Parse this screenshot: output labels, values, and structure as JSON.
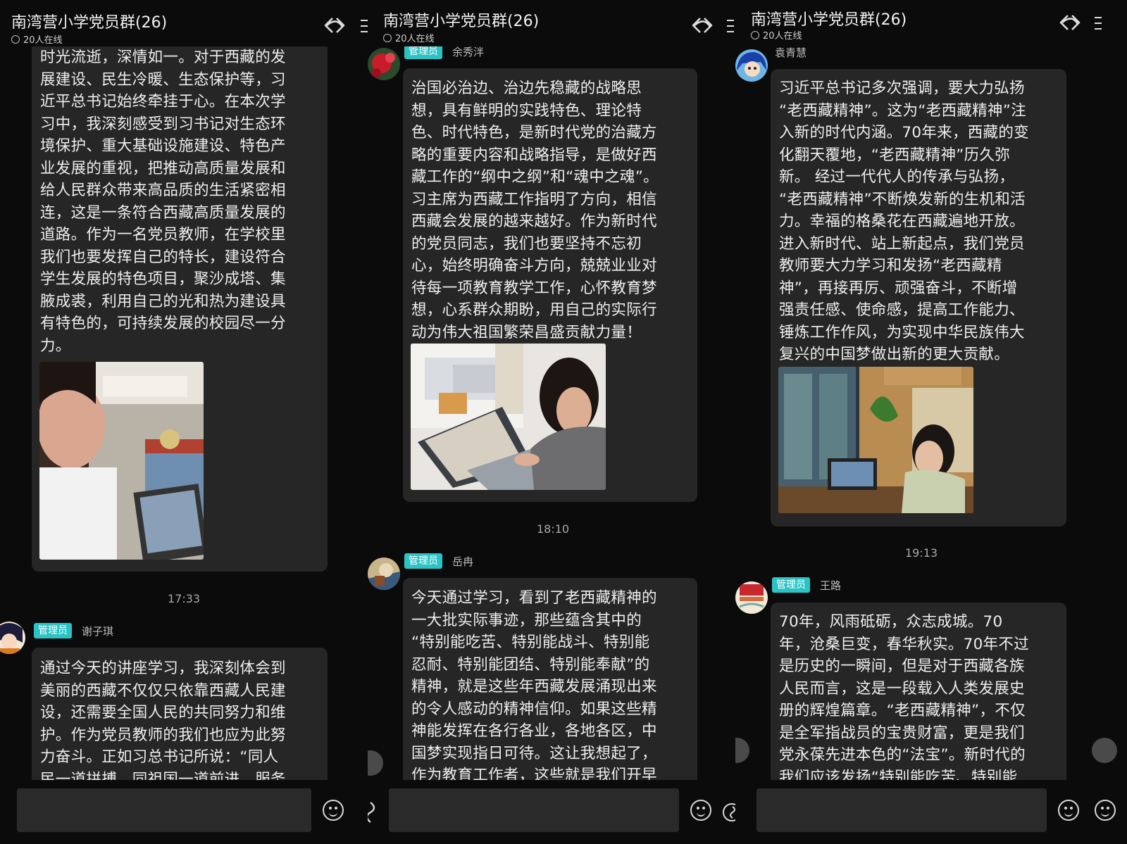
{
  "title": "南湾营小学党员群(26)",
  "online": "20人在线",
  "badge": "管理员",
  "panel1": {
    "msg1_text": "时光流逝，深情如一。对于西藏的发\n展建设、民生冷暖、生态保护等，习\n近平总书记始终牵挂于心。在本次学\n习中，我深刻感受到习书记对生态环\n境保护、重大基础设施建设、特色产\n业发展的重视，把推动高质量发展和\n给人民群众带来高品质的生活紧密相\n连，这是一条符合西藏高质量发展的\n道路。作为一名党员教师，在学校里\n我们也要发挥自己的特长，建设符合\n学生发展的特色项目，聚沙成塔、集\n腋成裘，利用自己的光和热为建设具\n有特色的，可持续发展的校园尽一分\n力。",
    "time": "17:33",
    "sender2": "谢子琪",
    "msg2_text": "通过今天的讲座学习，我深刻体会到\n美丽的西藏不仅仅只依靠西藏人民建\n设，还需要全国人民的共同努力和维\n护。作为党员教师的我们也应为此努\n力奋斗。正如习总书记所说：“同人\n民一道拼搏、同祖国一道前进，服务"
  },
  "panel2": {
    "sender1": "余秀泮",
    "msg1_text": "治国必治边、治边先稳藏的战略思\n想，具有鲜明的实践特色、理论特\n色、时代特色，是新时代党的治藏方\n略的重要内容和战略指导，是做好西\n藏工作的“纲中之纲”和“魂中之魂”。\n习主席为西藏工作指明了方向，相信\n西藏会发展的越来越好。作为新时代\n的党员同志，我们也要坚持不忘初\n心，始终明确奋斗方向，兢兢业业对\n待每一项教育教学工作，心怀教育梦\n想，心系群众期盼，用自己的实际行\n动为伟大祖国繁荣昌盛贡献力量！",
    "time": "18:10",
    "sender2": "岳冉",
    "msg2_text": "今天通过学习，看到了老西藏精神的\n一大批实际事迹，那些蕴含其中的\n“特别能吃苦、特别能战斗、特别能\n忍耐、特别能团结、特别能奉献”的\n精神，就是这些年西藏发展涌现出来\n的令人感动的精神信仰。如果这些精\n神能发挥在各行各业，各地各区，中\n国梦实现指日可待。这让我想起了，\n作为教育工作者，这些就是我们开早"
  },
  "panel3": {
    "sender1": "袁青慧",
    "msg1_text": "习近平总书记多次强调，要大力弘扬\n“老西藏精神”。这为“老西藏精神”注\n入新的时代内涵。70年来，西藏的变\n化翻天覆地，“老西藏精神”历久弥\n新。 经过一代代人的传承与弘扬，\n“老西藏精神”不断焕发新的生机和活\n力。幸福的格桑花在西藏遍地开放。\n进入新时代、站上新起点，我们党员\n教师要大力学习和发扬“老西藏精\n神”，再接再厉、顽强奋斗，不断增\n强责任感、使命感，提高工作能力、\n锤炼工作作风，为实现中华民族伟大\n复兴的中国梦做出新的更大贡献。",
    "time": "19:13",
    "sender2": "王路",
    "msg2_text": "70年，风雨砥砺，众志成城。70\n年，沧桑巨变，春华秋实。70年不过\n是历史的一瞬间，但是对于西藏各族\n人民而言，这是一段载入人类发展史\n册的辉煌篇章。“老西藏精神”，不仅\n是全军指战员的宝贵财富，更是我们\n党永葆先进本色的“法宝”。新时代的\n我们应该发扬“特别能吃苦、特别能"
  },
  "icons": {
    "share": "share-icon",
    "menu": "menu-icon",
    "emoji": "emoji-icon",
    "voice": "voice-icon",
    "check": "check-circle-icon"
  },
  "colors": {
    "background": "#0b0b0b",
    "bubble": "#262626",
    "badge": "#2bc4c6",
    "text": "#efefef"
  }
}
